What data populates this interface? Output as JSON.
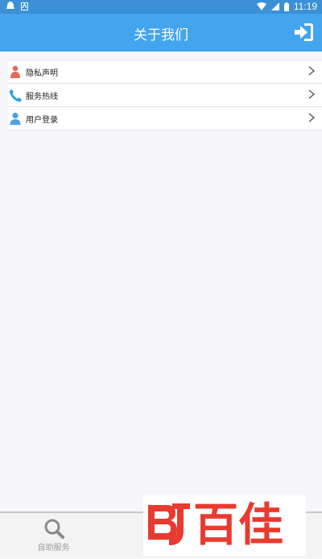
{
  "status_bar": {
    "time": "11:19",
    "icons": [
      "app-notification-icon",
      "download-notification-icon",
      "wifi-icon",
      "signal-icon",
      "battery-icon"
    ]
  },
  "header": {
    "title": "关于我们",
    "action_icon": "login-arrow-icon"
  },
  "menu": {
    "items": [
      {
        "label": "隐私声明",
        "icon": "person-icon",
        "icon_color": "#e2685b"
      },
      {
        "label": "服务热线",
        "icon": "phone-icon",
        "icon_color": "#2aa2dc"
      },
      {
        "label": "用户登录",
        "icon": "user-icon",
        "icon_color": "#4aa2e0"
      }
    ]
  },
  "tabbar": {
    "tabs": [
      {
        "label": "自助服务",
        "icon": "search-icon"
      }
    ]
  },
  "watermark": {
    "logo_text": "百佳",
    "accent_color": "#e83a2f"
  },
  "colors": {
    "status_bar": "#3c90d6",
    "header": "#42a5ee",
    "background": "#f7f7fb"
  }
}
